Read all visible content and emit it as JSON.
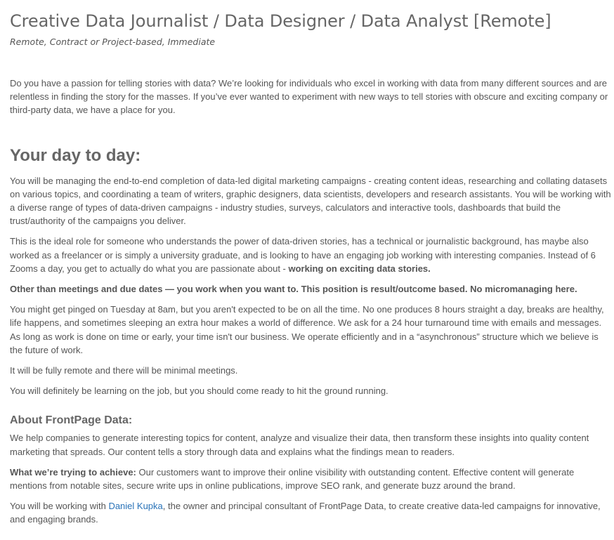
{
  "job": {
    "title": "Creative Data Journalist / Data Designer / Data Analyst [Remote]",
    "subtitle": "Remote, Contract or Project-based, Immediate"
  },
  "intro": "Do you have a passion for telling stories with data? We’re looking for individuals who excel in working with data from many different sources and are relentless in finding the story for the masses. If you’ve ever wanted to experiment with new ways to tell stories with obscure and exciting company or third-party data, we have a place for you.",
  "day_to_day": {
    "heading": "Your day to day:",
    "p1": "You will be managing the end-to-end completion of data-led digital marketing campaigns - creating content ideas, researching and collating datasets on various topics, and coordinating a team of writers, graphic designers, data scientists, developers and research assistants. You will be working with a diverse range of types of data-driven campaigns - industry studies, surveys, calculators and interactive tools, dashboards that build the trust/authority of the campaigns you deliver.",
    "p2_text": "This is the ideal role for someone who understands the power of data-driven stories, has a technical or journalistic background, has maybe also worked as a freelancer or is simply a university graduate, and is looking to have an engaging job working with interesting companies. Instead of 6 Zooms a day, you get to actually do what you are passionate about - ",
    "p2_bold": "working on exciting data stories.",
    "p3_bold": "Other than meetings and due dates — you work when you want to. This position is result/outcome based. No micromanaging here.",
    "p4": "You might get pinged on Tuesday at 8am, but you aren't expected to be on all the time. No one produces 8 hours straight a day, breaks are healthy, life happens, and sometimes sleeping an extra hour makes a world of difference. We ask for a 24 hour turnaround time with emails and messages. As long as work is done on time or early, your time isn't our business. We operate efficiently and in a “asynchronous” structure which we believe is the future of work.",
    "p5": "It will be fully remote and there will be minimal meetings.",
    "p6": "You will definitely be learning on the job, but you should come ready to hit the ground running."
  },
  "about": {
    "heading": "About FrontPage Data:",
    "p1": "We help companies to generate interesting topics for content, analyze and visualize their data, then transform these insights into quality content marketing that spreads. Our content tells a story through data and explains what the findings mean to readers.",
    "p2_bold": "What we’re trying to achieve:",
    "p2_text": " Our customers want to improve their online visibility with outstanding content. Effective content will generate mentions from notable sites, secure write ups in online publications, improve SEO rank, and generate buzz around the brand.",
    "p3_before": "You will be working with ",
    "p3_link": "Daniel Kupka",
    "p3_after": ", the owner and principal consultant of FrontPage Data, to create creative data-led campaigns for innovative, and engaging brands."
  },
  "colors": {
    "heading": "#666666",
    "body_text": "#555555",
    "link": "#2a73b8"
  }
}
